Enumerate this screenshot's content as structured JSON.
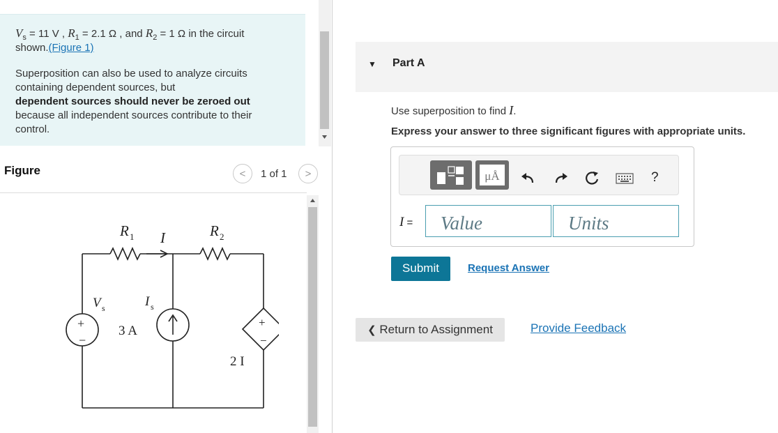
{
  "intro": {
    "vs_symbol": "V",
    "vs_sub": "s",
    "vs_value": " = 11 V ,",
    "r1_symbol": "R",
    "r1_sub": "1",
    "r1_value": " = 2.1 Ω ,",
    "and": " and ",
    "r2_symbol": "R",
    "r2_sub": "2",
    "r2_value": " = 1 Ω",
    "circuit_text": " in the circuit",
    "shown": "shown.",
    "figure_link": "(Figure 1)",
    "p2_line1": "Superposition can also be used to analyze circuits",
    "p2_line2": "containing dependent sources, but",
    "p2_bold": "dependent sources should never be zeroed out",
    "p2_line3": "because all independent sources contribute to their",
    "p2_line4": "control."
  },
  "figure": {
    "title": "Figure",
    "prev": "<",
    "next": ">",
    "page_count": "1 of 1",
    "circuit": {
      "r1": "R",
      "r1_sub": "1",
      "r2": "R",
      "r2_sub": "2",
      "current": "I",
      "vs": "V",
      "vs_sub": "s",
      "is": "I",
      "is_sub": "s",
      "is_value": "3 A",
      "dep_value": "2 I",
      "plus": "+",
      "minus": "−"
    }
  },
  "part": {
    "caret": "▼",
    "title": "Part A",
    "question_prefix": "Use superposition to find ",
    "question_var": "I",
    "question_suffix": ".",
    "instruction": "Express your answer to three significant figures with appropriate units."
  },
  "toolbar": {
    "units_label": "μÅ",
    "undo_icon": "undo-icon",
    "redo_icon": "redo-icon",
    "reset_icon": "reset-icon",
    "keyboard_icon": "keyboard-icon",
    "help": "?"
  },
  "answer": {
    "var": "I",
    "equals": " =",
    "value_placeholder": "Value",
    "units_placeholder": "Units"
  },
  "actions": {
    "submit": "Submit",
    "request_answer": "Request Answer",
    "return": "Return to Assignment",
    "return_caret": "❮",
    "feedback": "Provide Feedback"
  },
  "colors": {
    "intro_bg": "#e8f5f6",
    "link": "#1a73b5",
    "submit_bg": "#0d7697"
  }
}
